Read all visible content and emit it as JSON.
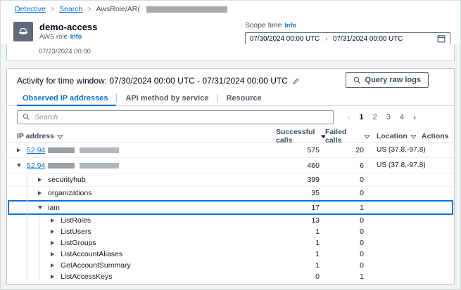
{
  "breadcrumb": {
    "separator": ">",
    "items": [
      {
        "label": "Detective"
      },
      {
        "label": "Search"
      },
      {
        "label": "AwsRole/AR("
      }
    ]
  },
  "header": {
    "title": "demo-access",
    "subtitle": "AWS role",
    "info_label": "Info"
  },
  "scope_time": {
    "label": "Scope time",
    "info_label": "Info",
    "start": "07/30/2024 00:00 UTC",
    "separator": "›",
    "end": "07/31/2024 00:00 UTC"
  },
  "timeline": {
    "partial_tick": "07/23/2024 00:00"
  },
  "activity": {
    "title": "Activity for time window: 07/30/2024 00:00 UTC - 07/31/2024 00:00 UTC",
    "query_button": "Query raw logs"
  },
  "tabs": [
    {
      "label": "Observed IP addresses",
      "active": true
    },
    {
      "label": "API method by service",
      "active": false
    },
    {
      "label": "Resource",
      "active": false
    }
  ],
  "toolbar": {
    "search_placeholder": "Search",
    "pagination": {
      "prev": "‹",
      "pages": [
        "1",
        "2",
        "3",
        "4"
      ],
      "current": "1",
      "next": "›"
    }
  },
  "table": {
    "columns": [
      {
        "label": "IP address",
        "sort": "sortable"
      },
      {
        "label": "Successful calls",
        "sort": "desc"
      },
      {
        "label": "Failed calls",
        "sort": "sortable"
      },
      {
        "label": "Location",
        "sort": "sortable"
      },
      {
        "label": "Actions",
        "sort": null
      }
    ],
    "rows": [
      {
        "level": 0,
        "expanded": false,
        "name": "52.94",
        "redacted": true,
        "successful": "575",
        "failed": "20",
        "location": "US (37.8,-97.8)"
      },
      {
        "level": 0,
        "expanded": true,
        "name": "52.94",
        "redacted": true,
        "successful": "460",
        "failed": "6",
        "location": "US (37.8,-97.8)"
      },
      {
        "level": 1,
        "expanded": false,
        "name": "securityhub",
        "successful": "399",
        "failed": "0"
      },
      {
        "level": 1,
        "expanded": false,
        "name": "organizations",
        "successful": "35",
        "failed": "0"
      },
      {
        "level": 1,
        "expanded": true,
        "selected": true,
        "name": "iam",
        "successful": "17",
        "failed": "1"
      },
      {
        "level": 2,
        "expanded": false,
        "name": "ListRoles",
        "successful": "13",
        "failed": "0"
      },
      {
        "level": 2,
        "expanded": false,
        "name": "ListUsers",
        "successful": "1",
        "failed": "0"
      },
      {
        "level": 2,
        "expanded": false,
        "name": "ListGroups",
        "successful": "1",
        "failed": "0"
      },
      {
        "level": 2,
        "expanded": false,
        "name": "ListAccountAliases",
        "successful": "1",
        "failed": "0"
      },
      {
        "level": 2,
        "expanded": false,
        "name": "GetAccountSummary",
        "successful": "1",
        "failed": "0"
      },
      {
        "level": 2,
        "expanded": false,
        "name": "ListAccessKeys",
        "successful": "0",
        "failed": "1"
      }
    ]
  },
  "colors": {
    "accent": "#0972d3",
    "selected_row_border": "#0972d3",
    "entity_icon_bg": "#5f6b7a",
    "redaction_gray": "#a6a9ad",
    "page_background": "#f2f3f3"
  }
}
